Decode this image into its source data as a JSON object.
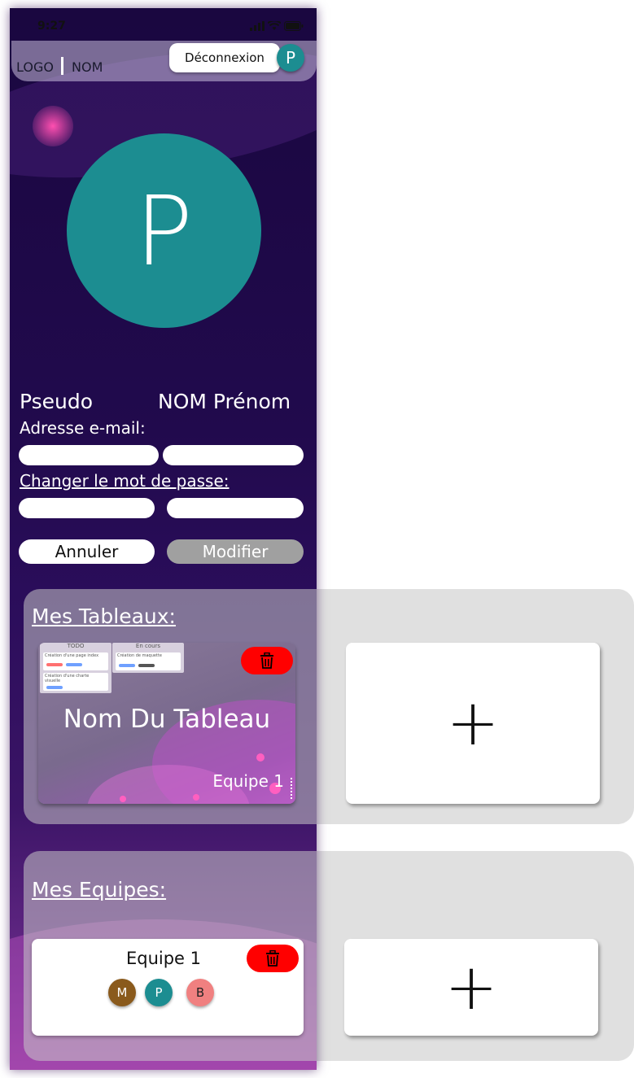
{
  "status": {
    "time": "9:27"
  },
  "header": {
    "logo": "LOGO",
    "name": "NOM",
    "logout_label": "Déconnexion",
    "avatar_initial": "P"
  },
  "profile": {
    "avatar_initial": "P",
    "pseudo": "Pseudo",
    "fullname": "NOM Prénom",
    "email_label": "Adresse e-mail:",
    "password_label": "Changer le mot de passe:",
    "cancel_label": "Annuler",
    "modify_label": "Modifier"
  },
  "boards": {
    "title": "Mes Tableaux:",
    "items": [
      {
        "name": "Nom Du Tableau",
        "team": "Equipe 1",
        "preview": {
          "col1": "TODO",
          "col2": "En cours",
          "task1": "Création d'une page index",
          "task2": "Création d'une charte visuelle",
          "task3": "Création de maquette"
        }
      }
    ],
    "add_label": "+"
  },
  "teams": {
    "title": "Mes Equipes:",
    "items": [
      {
        "name": "Equipe 1",
        "members": [
          {
            "initial": "M",
            "color": "#8a5a1c"
          },
          {
            "initial": "P",
            "color": "#1c8d91"
          },
          {
            "initial": "B",
            "color": "#f08080"
          }
        ]
      }
    ],
    "add_label": "+"
  },
  "colors": {
    "accent": "#1c8d91",
    "danger": "#ff0000",
    "modify": "#a0a0a0"
  }
}
